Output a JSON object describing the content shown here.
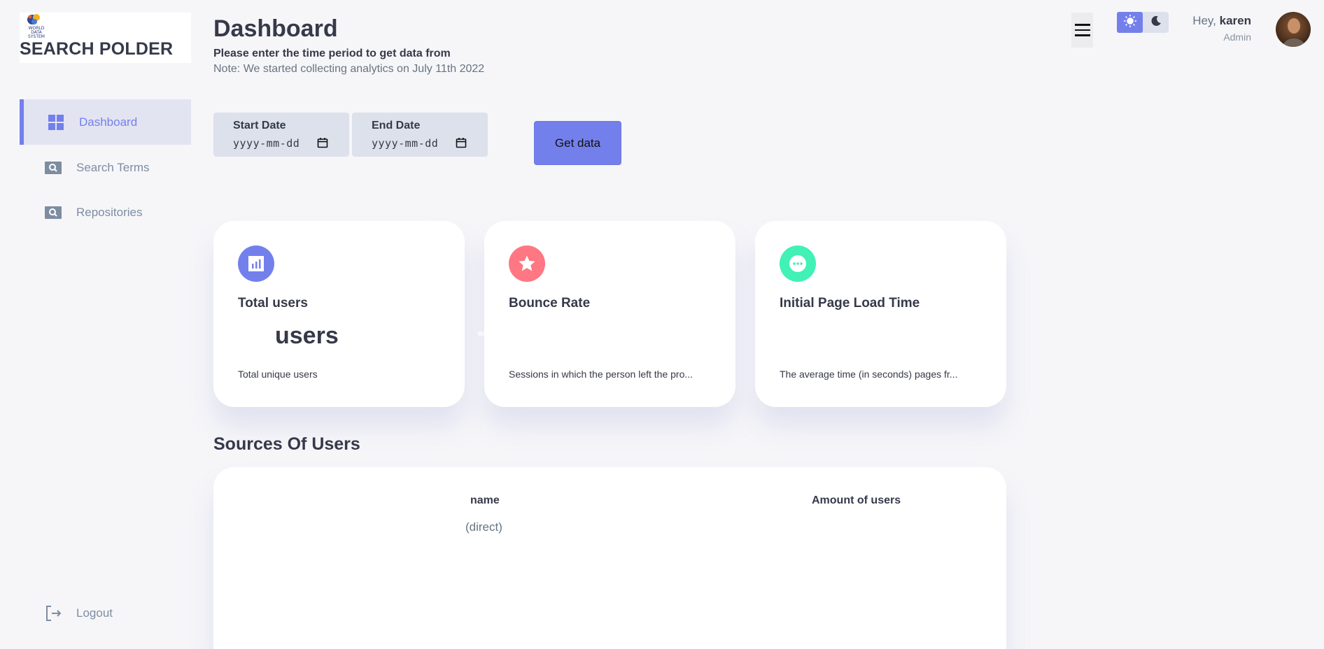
{
  "brand": {
    "title": "SEARCH POLDER",
    "logo_small_text": "WORLD DATA SYSTEM"
  },
  "sidebar": {
    "items": [
      {
        "label": "Dashboard",
        "icon": "grid-icon",
        "active": true
      },
      {
        "label": "Search Terms",
        "icon": "search-icon",
        "active": false
      },
      {
        "label": "Repositories",
        "icon": "search-icon",
        "active": false
      }
    ],
    "logout_label": "Logout"
  },
  "header": {
    "title": "Dashboard",
    "period_hint": "Please enter the time period to get data from",
    "note": "Note: We started collecting analytics on July 11th 2022"
  },
  "filters": {
    "start_label": "Start Date",
    "start_value": "yyyy-mm-dd",
    "end_label": "End Date",
    "end_value": "yyyy-mm-dd",
    "submit_label": "Get data"
  },
  "cards": [
    {
      "title": "Total users",
      "value": "users",
      "description": "Total unique users",
      "icon": "chart-icon",
      "color": "#7380ec"
    },
    {
      "title": "Bounce Rate",
      "value": "",
      "description": "Sessions in which the person left the pro...",
      "icon": "star-icon",
      "color": "#ff7782"
    },
    {
      "title": "Initial Page Load Time",
      "value": "",
      "description": "The average time (in seconds) pages fr...",
      "icon": "more-icon",
      "color": "#41f1b6"
    }
  ],
  "sources": {
    "title": "Sources Of Users",
    "columns": [
      "name",
      "Amount of users"
    ],
    "rows": [
      {
        "name": "(direct)",
        "amount": ""
      }
    ]
  },
  "profile": {
    "greeting": "Hey, ",
    "name": "karen",
    "role": "Admin"
  },
  "colors": {
    "primary": "#7380ec",
    "danger": "#ff7782",
    "success": "#41f1b6",
    "background": "#f6f6f9"
  }
}
